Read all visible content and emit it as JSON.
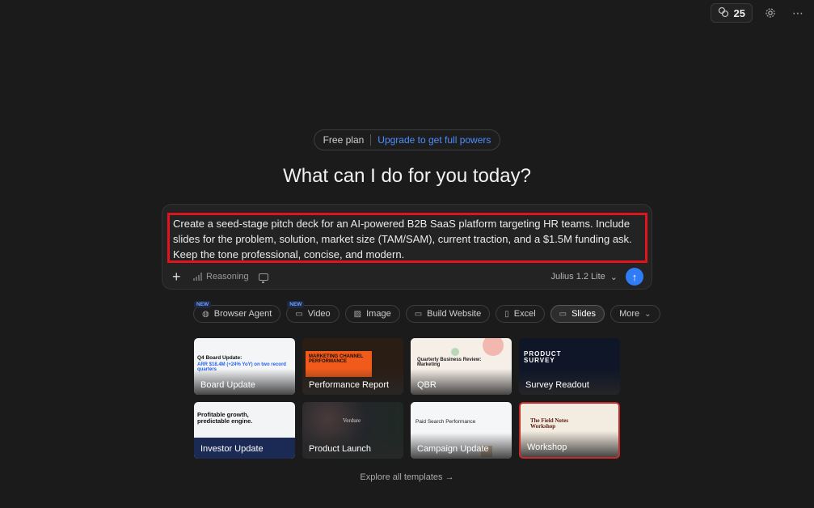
{
  "topbar": {
    "credits": "25",
    "credits_icon": "coins-icon",
    "settings_icon": "gear-icon",
    "more_icon": "ellipsis-icon"
  },
  "plan": {
    "free": "Free plan",
    "upgrade": "Upgrade to get full powers"
  },
  "headline": "What can I do for you today?",
  "composer": {
    "prompt": "Create a seed-stage pitch deck for an AI-powered B2B SaaS platform targeting HR teams. Include slides for the problem, solution, market size (TAM/SAM), current traction, and a $1.5M funding ask. Keep the tone professional, concise, and modern.",
    "reasoning": "Reasoning",
    "model": "Julius 1.2 Lite"
  },
  "chips": [
    {
      "label": "Browser Agent",
      "badge": "NEW",
      "icon": "globe-icon"
    },
    {
      "label": "Video",
      "badge": "NEW",
      "icon": "video-icon"
    },
    {
      "label": "Image",
      "icon": "image-icon"
    },
    {
      "label": "Build Website",
      "icon": "browser-window-icon"
    },
    {
      "label": "Excel",
      "icon": "file-icon"
    },
    {
      "label": "Slides",
      "icon": "presentation-icon"
    },
    {
      "label": "More",
      "icon": "chevron-down-icon"
    }
  ],
  "templates": [
    {
      "label": "Board Update",
      "thumb_title": "Q4 Board Update:",
      "thumb_sub": "ARR $18.4M (+24% YoY) on two record quarters"
    },
    {
      "label": "Performance Report",
      "thumb_title": "MARKETING CHANNEL PERFORMANCE"
    },
    {
      "label": "QBR",
      "thumb_title": "Quarterly Business Review: Marketing"
    },
    {
      "label": "Survey Readout",
      "thumb_title": "PRODUCT SURVEY"
    },
    {
      "label": "Investor Update",
      "thumb_title": "Profitable growth, predictable engine."
    },
    {
      "label": "Product Launch",
      "thumb_title": "Verdure"
    },
    {
      "label": "Campaign Update",
      "thumb_title": "Paid Search Performance"
    },
    {
      "label": "Workshop",
      "thumb_title": "The Field Notes Workshop"
    }
  ],
  "explore": "Explore all templates →"
}
